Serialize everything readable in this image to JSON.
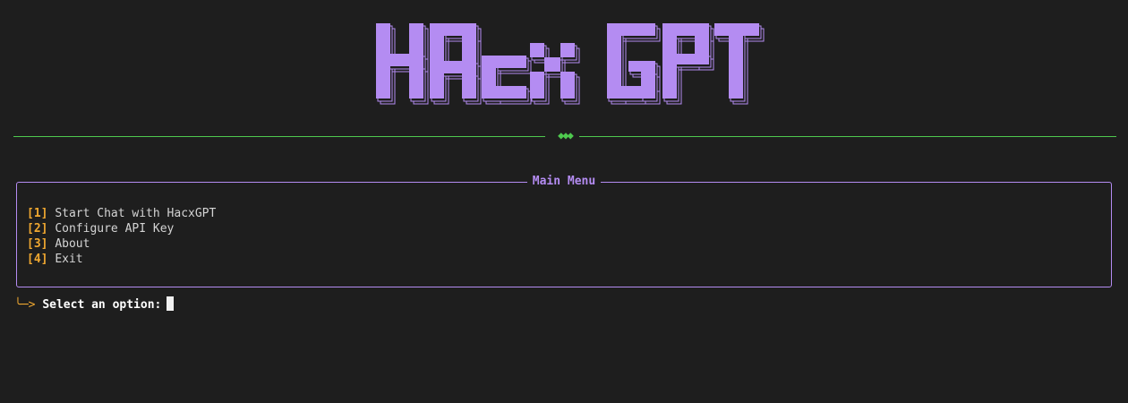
{
  "banner": {
    "text": "HACX GPT"
  },
  "colors": {
    "background": "#1e1e1e",
    "banner": "#b48cf2",
    "divider": "#4ec94e",
    "menu_border": "#b48cf2",
    "option_number": "#f0a830",
    "prompt_arrow": "#f0a830"
  },
  "divider": {
    "ornament": "◆◆◆"
  },
  "menu": {
    "title": "Main Menu",
    "items": [
      {
        "number": "[1]",
        "label": "Start Chat with HacxGPT"
      },
      {
        "number": "[2]",
        "label": "Configure API Key"
      },
      {
        "number": "[3]",
        "label": "About"
      },
      {
        "number": "[4]",
        "label": "Exit"
      }
    ]
  },
  "prompt": {
    "arrow": "╰─>",
    "label": "Select an option:",
    "value": ""
  }
}
